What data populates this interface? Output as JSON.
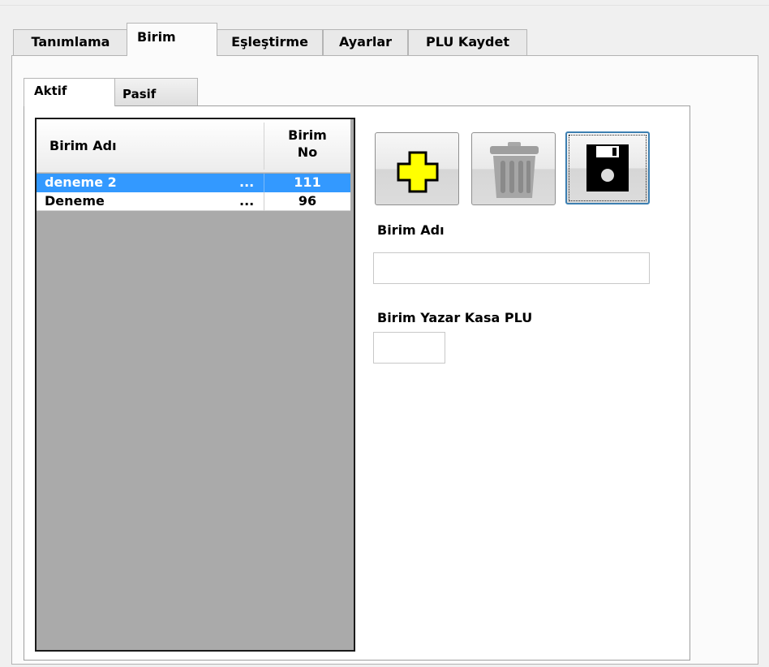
{
  "main_tabs": [
    {
      "label": "Tanımlama",
      "active": false
    },
    {
      "label": "Birim",
      "active": true
    },
    {
      "label": "Eşleştirme",
      "active": false
    },
    {
      "label": "Ayarlar",
      "active": false
    },
    {
      "label": "PLU Kaydet",
      "active": false
    }
  ],
  "sub_tabs": [
    {
      "label": "Aktif",
      "active": true
    },
    {
      "label": "Pasif",
      "active": false
    }
  ],
  "grid": {
    "columns": [
      "Birim Adı",
      "Birim",
      "No"
    ],
    "rows": [
      {
        "name": "deneme 2",
        "ellipsis": "...",
        "no": "111",
        "selected": true
      },
      {
        "name": "Deneme",
        "ellipsis": "...",
        "no": "96",
        "selected": false
      }
    ]
  },
  "toolbar": {
    "add_icon": "plus-icon",
    "delete_icon": "trash-icon",
    "save_icon": "floppy-disk-icon"
  },
  "form": {
    "birim_adi_label": "Birim Adı",
    "birim_adi_value": "",
    "plu_label": "Birim Yazar Kasa PLU",
    "plu_value": ""
  },
  "colors": {
    "selection": "#3399ff",
    "plus_icon": "#ffff00",
    "grid_background": "#aaaaaa"
  }
}
